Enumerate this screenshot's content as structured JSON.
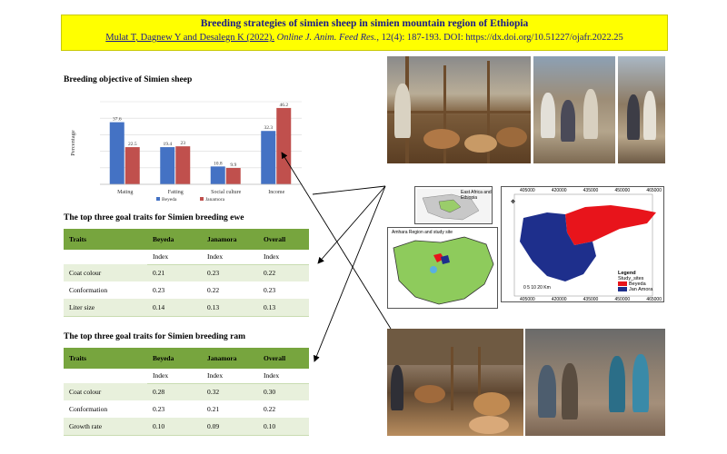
{
  "header": {
    "title": "Breeding strategies of simien sheep in simien mountain region of Ethiopia",
    "authors": "Mulat T, Dagnew Y and Desalegn K (2022).",
    "journal": "Online J. Anim. Feed Res.",
    "citation_rest": ", 12(4): 187-193. DOI: https://dx.doi.org/10.51227/ojafr.2022.25"
  },
  "chart_section": {
    "title": "Breeding objective of Simien sheep"
  },
  "chart_data": {
    "type": "bar",
    "ylabel": "Percentage",
    "categories": [
      "Mating",
      "Fatting",
      "Social culture",
      "Income"
    ],
    "series": [
      {
        "name": "Beyeda",
        "color": "#4472c4",
        "values": [
          37.6,
          22.5,
          10.8,
          32.3
        ]
      },
      {
        "name": "Janamora",
        "color": "#c0504d",
        "values": [
          22.5,
          23,
          9.9,
          46.2
        ]
      }
    ],
    "value_labels": [
      [
        "37.6",
        "19.4",
        "10.8",
        "32.3"
      ],
      [
        "22.5",
        "23",
        "9.9",
        "46.2"
      ]
    ],
    "grid": true,
    "legend": "bottom"
  },
  "ewe_table": {
    "title": "The top three goal traits for Simien breeding ewe",
    "headers": [
      "Traits",
      "Beyeda",
      "Janamora",
      "Overall"
    ],
    "sub": [
      "Index",
      "Index",
      "Index"
    ],
    "rows": [
      [
        "Coat colour",
        "0.21",
        "0.23",
        "0.22"
      ],
      [
        "Conformation",
        "0.23",
        "0.22",
        "0.23"
      ],
      [
        "Liter size",
        "0.14",
        "0.13",
        "0.13"
      ]
    ]
  },
  "ram_table": {
    "title": "The top three goal traits for Simien breeding ram",
    "headers": [
      "Traits",
      "Beyeda",
      "Janamora",
      "Overall"
    ],
    "sub": [
      "Index",
      "Index",
      "Index"
    ],
    "rows": [
      [
        "Coat colour",
        "0.28",
        "0.32",
        "0.30"
      ],
      [
        "Conformation",
        "0.23",
        "0.21",
        "0.22"
      ],
      [
        "Growth rate",
        "0.10",
        "0.09",
        "0.10"
      ]
    ]
  },
  "maps": {
    "inset_label": "East Africa and Ethiopia",
    "amhara_label": "Amhara Region and study site",
    "top_ticks": [
      "405000",
      "420000",
      "435000",
      "450000",
      "465000"
    ],
    "bottom_ticks": [
      "405000",
      "420000",
      "435000",
      "450000",
      "465000"
    ],
    "scale": "0  5  10     20 Km",
    "legend_title": "Legend",
    "legend_sub": "Study_sites",
    "legend_items": [
      {
        "name": "Beyeda",
        "color": "#e8141b"
      },
      {
        "name": "Jan Amora",
        "color": "#1e2f8c"
      }
    ]
  },
  "colors": {
    "banner": "#ffff00",
    "table_header": "#77a53e",
    "table_stripe": "#e8f0dc"
  }
}
